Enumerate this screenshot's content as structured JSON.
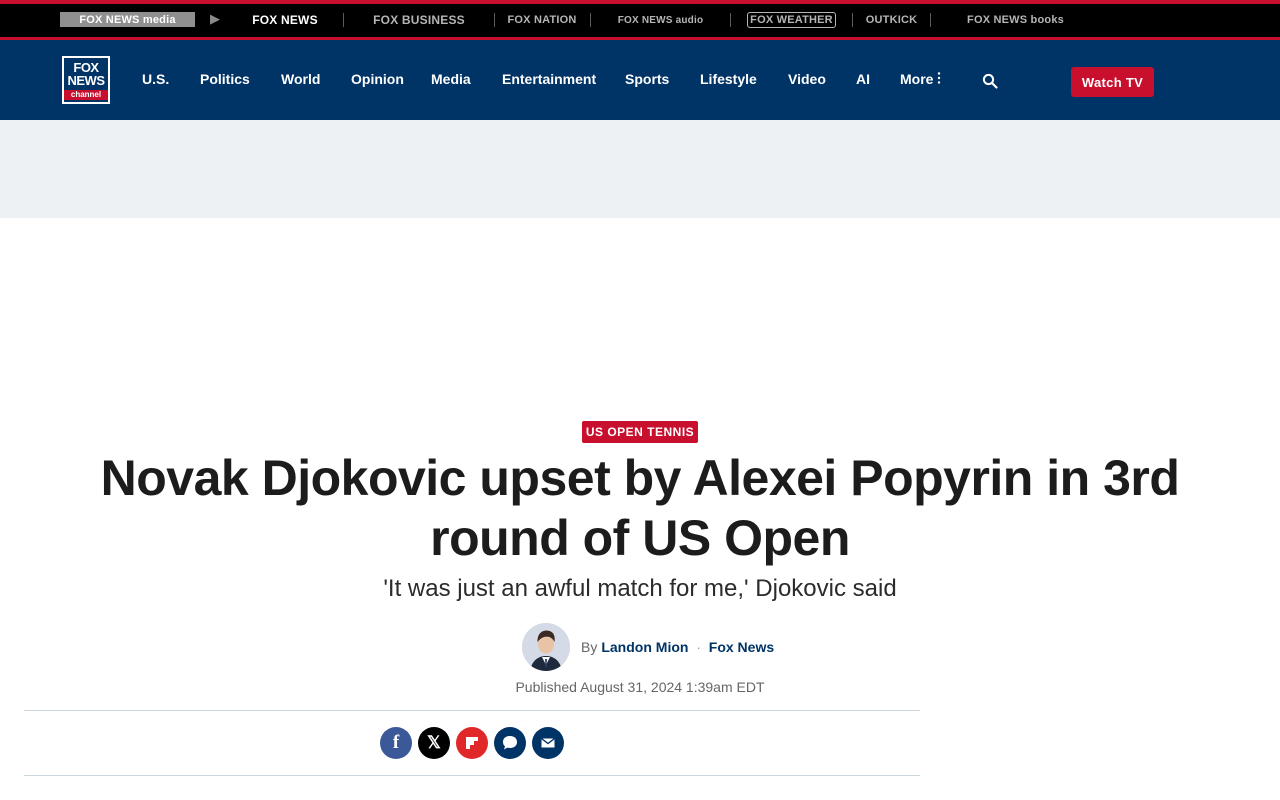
{
  "network_bar": {
    "items": [
      {
        "label": "FOX NEWS media",
        "icon": "fox-news-media-logo"
      },
      {
        "label": "FOX NEWS",
        "icon": "fox-news-logo"
      },
      {
        "label": "FOX BUSINESS",
        "icon": "fox-business-logo"
      },
      {
        "label": "FOX NATION",
        "icon": "fox-nation-logo"
      },
      {
        "label": "FOX NEWS audio",
        "icon": "fox-news-audio-logo"
      },
      {
        "label": "FOX WEATHER",
        "icon": "fox-weather-logo"
      },
      {
        "label": "OUTKICK",
        "icon": "outkick-logo"
      },
      {
        "label": "FOX NEWS books",
        "icon": "fox-news-books-logo"
      }
    ]
  },
  "nav": {
    "logo": {
      "line1": "FOX",
      "line2": "NEWS",
      "line3": "channel"
    },
    "links": [
      "U.S.",
      "Politics",
      "World",
      "Opinion",
      "Media",
      "Entertainment",
      "Sports",
      "Lifestyle",
      "Video",
      "AI",
      "More"
    ],
    "watch_tv": "Watch TV"
  },
  "article": {
    "eyebrow": "US OPEN TENNIS",
    "headline": "Novak Djokovic upset by Alexei Popyrin in 3rd round of US Open",
    "subhead": "'It was just an awful match for me,' Djokovic said",
    "byline_prefix": "By",
    "author": "Landon Mion",
    "dot": "·",
    "source": "Fox News",
    "published": "Published August 31, 2024 1:39am EDT"
  },
  "share": {
    "facebook_glyph": "f",
    "x_glyph": "𝕏"
  },
  "colors": {
    "brand_navy": "#003366",
    "brand_red": "#c8102e",
    "ad_band": "#edf1f4"
  }
}
